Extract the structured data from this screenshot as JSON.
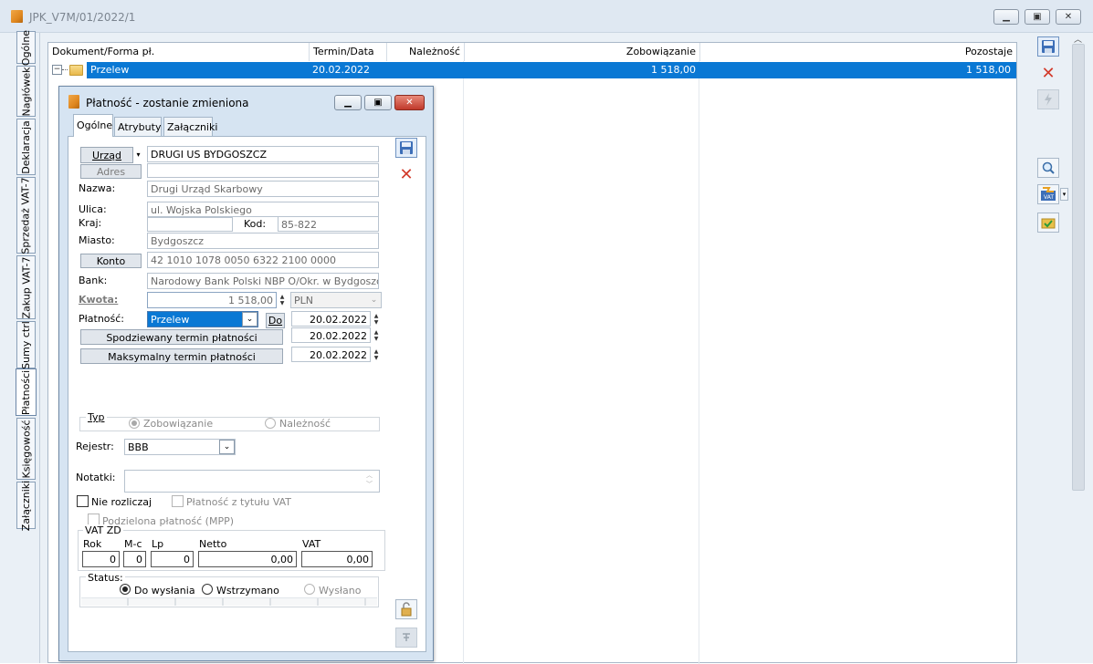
{
  "window": {
    "title": "JPK_V7M/01/2022/1"
  },
  "left_tabs": [
    {
      "label": "Ogólne"
    },
    {
      "label": "Nagłówek"
    },
    {
      "label": "Deklaracja"
    },
    {
      "label": "Sprzedaż VAT-7"
    },
    {
      "label": "Zakup VAT-7"
    },
    {
      "label": "Sumy ctrl"
    },
    {
      "label": "Płatności"
    },
    {
      "label": "Księgowość"
    },
    {
      "label": "Załączniki"
    }
  ],
  "grid": {
    "columns": [
      "Dokument/Forma pł.",
      "Termin/Data",
      "Należność",
      "Zobowiązanie",
      "Pozostaje"
    ],
    "rows": [
      {
        "doc": "Przelew",
        "date": "20.02.2022",
        "naleznosc": "",
        "zobowiazanie": "1 518,00",
        "pozostaje": "1 518,00",
        "expander": "−"
      }
    ]
  },
  "dialog": {
    "title": "Płatność - zostanie zmieniona",
    "tabs": [
      "Ogólne",
      "Atrybuty",
      "Załączniki"
    ],
    "urzad_button": "Urząd",
    "urzad_value": "DRUGI US BYDGOSZCZ",
    "adres_button": "Adres",
    "nazwa_label": "Nazwa:",
    "nazwa_value": "Drugi Urząd Skarbowy",
    "ulica_label": "Ulica:",
    "ulica_value": "ul. Wojska Polskiego",
    "kraj_label": "Kraj:",
    "kod_label": "Kod:",
    "kod_value": "85-822",
    "miasto_label": "Miasto:",
    "miasto_value": "Bydgoszcz",
    "konto_button": "Konto",
    "konto_value": "42 1010 1078 0050 6322 2100 0000",
    "bank_label": "Bank:",
    "bank_value": "Narodowy Bank Polski NBP O/Okr. w Bydgoszczy",
    "kwota_label": "Kwota:",
    "kwota_value": "1 518,00",
    "waluta_value": "PLN",
    "platnosc_label": "Płatność:",
    "platnosc_value": "Przelew",
    "do_button": "Do",
    "termin_value": "20.02.2022",
    "spodziewany_button": "Spodziewany termin płatności",
    "spodziewany_value": "20.02.2022",
    "maksymalny_button": "Maksymalny termin płatności",
    "maksymalny_value": "20.02.2022",
    "typ_label": "Typ",
    "typ_zobowiazanie": "Zobowiązanie",
    "typ_naleznosc": "Należność",
    "rejestr_label": "Rejestr:",
    "rejestr_value": "BBB",
    "notatki_label": "Notatki:",
    "nie_rozliczaj": "Nie rozliczaj",
    "platnosc_vat": "Płatność z tytułu VAT",
    "mpp": "Podzielona płatność (MPP)",
    "vatzd_label": "VAT ZD",
    "vatzd_cols": [
      "Rok",
      "M-c",
      "Lp",
      "Netto",
      "VAT"
    ],
    "vatzd_values": [
      "0",
      "0",
      "0",
      "0,00",
      "0,00"
    ],
    "status_label": "Status:",
    "status_options": [
      "Do wysłania",
      "Wstrzymano",
      "Wysłano"
    ]
  }
}
